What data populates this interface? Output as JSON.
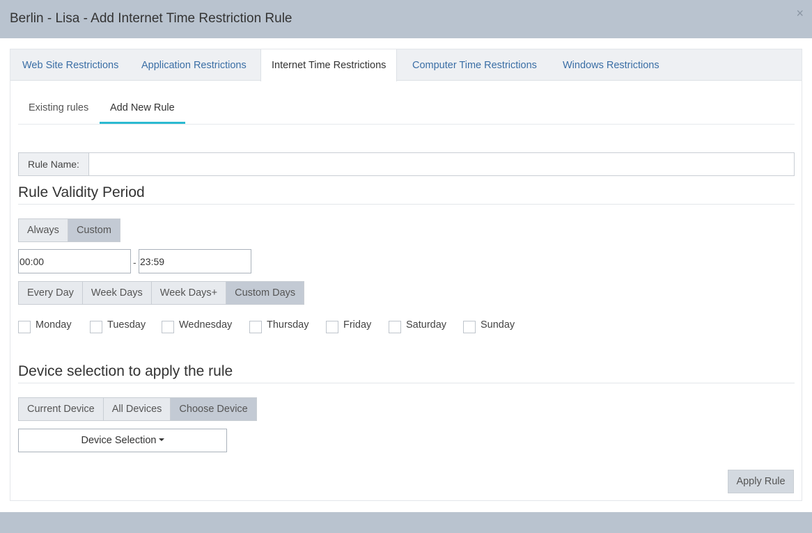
{
  "modal": {
    "title": "Berlin - Lisa - Add Internet Time Restriction Rule",
    "close_glyph": "×"
  },
  "main_tabs": [
    {
      "label": "Web Site Restrictions",
      "active": false
    },
    {
      "label": "Application Restrictions",
      "active": false
    },
    {
      "label": "Internet Time Restrictions",
      "active": true
    },
    {
      "label": "Computer Time Restrictions",
      "active": false
    },
    {
      "label": "Windows Restrictions",
      "active": false
    }
  ],
  "sub_tabs": [
    {
      "label": "Existing rules",
      "active": false
    },
    {
      "label": "Add New Rule",
      "active": true
    }
  ],
  "rule_name": {
    "label": "Rule Name:",
    "value": ""
  },
  "validity": {
    "title": "Rule Validity Period",
    "mode_buttons": [
      {
        "label": "Always",
        "selected": false
      },
      {
        "label": "Custom",
        "selected": true
      }
    ],
    "start_time": "00:00",
    "separator": "-",
    "end_time": "23:59",
    "day_mode_buttons": [
      {
        "label": "Every Day",
        "selected": false
      },
      {
        "label": "Week Days",
        "selected": false
      },
      {
        "label": "Week Days+",
        "selected": false
      },
      {
        "label": "Custom Days",
        "selected": true
      }
    ],
    "days": [
      {
        "label": "Monday",
        "checked": false
      },
      {
        "label": "Tuesday",
        "checked": false
      },
      {
        "label": "Wednesday",
        "checked": false
      },
      {
        "label": "Thursday",
        "checked": false
      },
      {
        "label": "Friday",
        "checked": false
      },
      {
        "label": "Saturday",
        "checked": false
      },
      {
        "label": "Sunday",
        "checked": false
      }
    ]
  },
  "device": {
    "title": "Device selection to apply the rule",
    "buttons": [
      {
        "label": "Current Device",
        "selected": false
      },
      {
        "label": "All Devices",
        "selected": false
      },
      {
        "label": "Choose Device",
        "selected": true
      }
    ],
    "dropdown_label": "Device Selection"
  },
  "apply_label": "Apply Rule"
}
